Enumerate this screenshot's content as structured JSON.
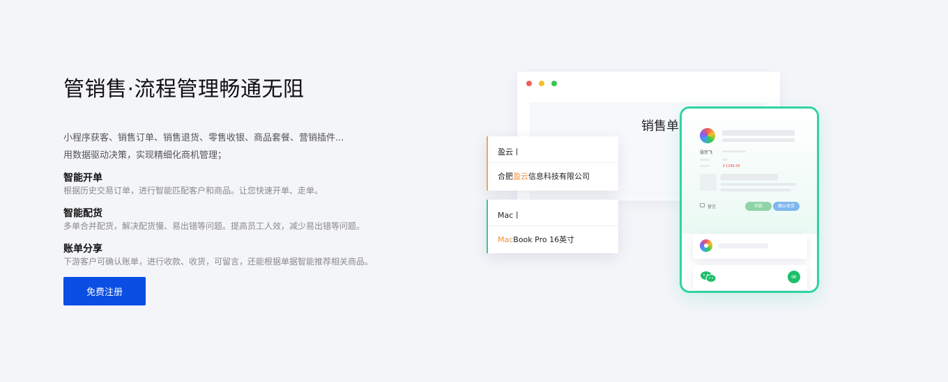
{
  "hero": {
    "title": "管销售·流程管理畅通无阻",
    "desc_line1": "小程序获客、销售订单、销售退货、零售收银、商品套餐、营销插件...",
    "desc_line2": "用数据驱动决策，实现精细化商机管理；",
    "features": [
      {
        "title": "智能开单",
        "desc": "根据历史交易订单，进行智能匹配客户和商品。让您快速开单、走单。"
      },
      {
        "title": "智能配货",
        "desc": "多单合并配货，解决配货慢、易出错等问题。提高员工人效，减少易出错等问题。"
      },
      {
        "title": "账单分享",
        "desc": "下游客户可确认账单，进行收款、收货，可留言，还能根据单据智能推荐相关商品。"
      }
    ],
    "cta_label": "免费注册"
  },
  "illustration": {
    "doc_title": "销售单",
    "customer_card": {
      "input_text": "盈云丨",
      "suggestion_highlight": "盈云",
      "suggestion_prefix": "合肥",
      "suggestion_suffix": "信息科技有限公司"
    },
    "product_card": {
      "input_text": "Mac丨",
      "suggestion_highlight": "Mac",
      "suggestion_suffix": "Book Pro 16英寸"
    },
    "phone": {
      "name": "张宗飞",
      "amount": "￥1299.00",
      "comment_label": "留言",
      "pay_label": "付款",
      "confirm_label": "确认收货",
      "accent_color": "#2ed3a0"
    }
  }
}
